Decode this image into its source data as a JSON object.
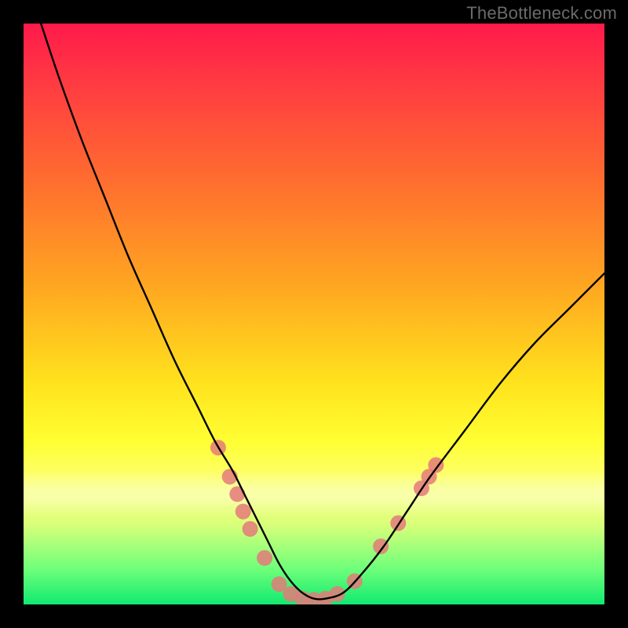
{
  "watermark": "TheBottleneck.com",
  "chart_data": {
    "type": "line",
    "title": "",
    "xlabel": "",
    "ylabel": "",
    "xlim": [
      0,
      100
    ],
    "ylim": [
      0,
      100
    ],
    "grid": false,
    "legend": false,
    "series": [
      {
        "name": "bottleneck-curve",
        "color": "#000000",
        "x": [
          3,
          6,
          10,
          14,
          18,
          22,
          26,
          30,
          33,
          36,
          38,
          40,
          42,
          44,
          46,
          48,
          50,
          52,
          55,
          58,
          62,
          66,
          70,
          76,
          82,
          88,
          94,
          100
        ],
        "y": [
          100,
          91,
          80,
          70,
          60,
          51,
          42,
          34,
          28,
          23,
          19,
          15,
          11,
          7,
          4,
          2,
          1,
          1,
          2,
          5,
          10,
          16,
          22,
          30,
          38,
          45,
          51,
          57
        ]
      }
    ],
    "markers": {
      "name": "highlight-points",
      "color": "#e47a7a",
      "radius_px": 10,
      "points": [
        {
          "x": 33.5,
          "y": 27
        },
        {
          "x": 35.5,
          "y": 22
        },
        {
          "x": 36.8,
          "y": 19
        },
        {
          "x": 37.8,
          "y": 16
        },
        {
          "x": 39.0,
          "y": 13
        },
        {
          "x": 41.5,
          "y": 8
        },
        {
          "x": 44.0,
          "y": 3.5
        },
        {
          "x": 46.0,
          "y": 1.8
        },
        {
          "x": 48.0,
          "y": 1.0
        },
        {
          "x": 50.0,
          "y": 0.8
        },
        {
          "x": 52.0,
          "y": 1.0
        },
        {
          "x": 54.0,
          "y": 1.8
        },
        {
          "x": 57.0,
          "y": 4.0
        },
        {
          "x": 61.5,
          "y": 10
        },
        {
          "x": 64.5,
          "y": 14
        },
        {
          "x": 68.5,
          "y": 20
        },
        {
          "x": 69.8,
          "y": 22
        },
        {
          "x": 71.0,
          "y": 24
        }
      ]
    }
  }
}
